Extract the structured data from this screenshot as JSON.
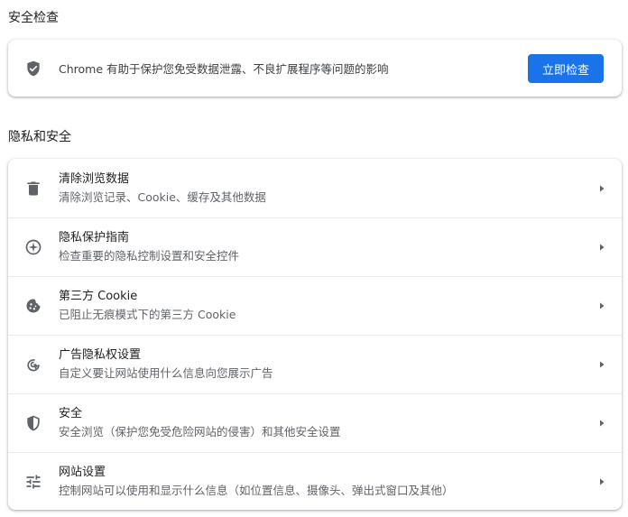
{
  "safety_check": {
    "section_title": "安全检查",
    "description": "Chrome 有助于保护您免受数据泄露、不良扩展程序等问题的影响",
    "button_label": "立即检查",
    "icon": "shield-check-icon"
  },
  "privacy": {
    "section_title": "隐私和安全",
    "items": [
      {
        "title": "清除浏览数据",
        "subtitle": "清除浏览记录、Cookie、缓存及其他数据",
        "icon": "trash-icon"
      },
      {
        "title": "隐私保护指南",
        "subtitle": "检查重要的隐私控制设置和安全控件",
        "icon": "compass-icon"
      },
      {
        "title": "第三方 Cookie",
        "subtitle": "已阻止无痕模式下的第三方 Cookie",
        "icon": "cookie-icon"
      },
      {
        "title": "广告隐私权设置",
        "subtitle": "自定义要让网站使用什么信息向您展示广告",
        "icon": "ad-privacy-icon"
      },
      {
        "title": "安全",
        "subtitle": "安全浏览（保护您免受危险网站的侵害）和其他安全设置",
        "icon": "shield-icon"
      },
      {
        "title": "网站设置",
        "subtitle": "控制网站可以使用和显示什么信息（如位置信息、摄像头、弹出式窗口及其他）",
        "icon": "tune-icon"
      }
    ]
  },
  "colors": {
    "accent": "#1a73e8",
    "icon": "#5f6368",
    "text_primary": "#202124",
    "text_secondary": "#5f6368"
  }
}
